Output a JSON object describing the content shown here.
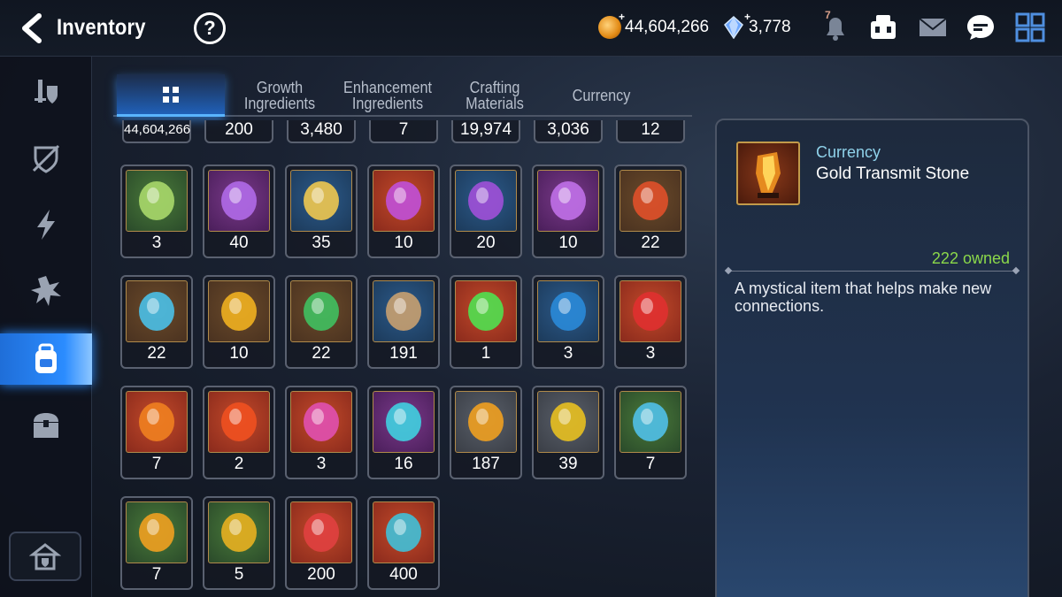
{
  "header": {
    "title": "Inventory",
    "help_label": "?",
    "gold_amount": "44,604,266",
    "crystal_amount": "3,778",
    "notification_count": "7"
  },
  "tabs": [
    {
      "label": "",
      "active": true
    },
    {
      "label": "Growth Ingredients"
    },
    {
      "label": "Enhancement Ingredients"
    },
    {
      "label": "Crafting Materials"
    },
    {
      "label": "Currency"
    }
  ],
  "top_row_counts": [
    "44,604,266",
    "200",
    "3,480",
    "7",
    "19,974",
    "3,036",
    "12"
  ],
  "items": [
    {
      "icon": "hero-portrait-icon",
      "count": "3"
    },
    {
      "icon": "purple-flower-icon",
      "count": "40"
    },
    {
      "icon": "gold-flower-icon",
      "count": "35"
    },
    {
      "icon": "moon-pentagon-rune-icon",
      "count": "10"
    },
    {
      "icon": "moon-triangle-rune-icon",
      "count": "20"
    },
    {
      "icon": "moon-oval-rune-icon",
      "count": "10"
    },
    {
      "icon": "red-fire-rune-icon",
      "count": "22"
    },
    {
      "icon": "blue-ice-rune-icon",
      "count": "22"
    },
    {
      "icon": "yellow-lightning-rune-icon",
      "count": "10"
    },
    {
      "icon": "green-earth-rune-icon",
      "count": "22"
    },
    {
      "icon": "herb-root-icon",
      "count": "191"
    },
    {
      "icon": "green-eye-gem-icon",
      "count": "1"
    },
    {
      "icon": "blue-circuit-orb-icon",
      "count": "3"
    },
    {
      "icon": "red-hexagon-gem-icon",
      "count": "3"
    },
    {
      "icon": "red-transmit-stone-icon",
      "count": "7"
    },
    {
      "icon": "red-bolt-stone-icon",
      "count": "2"
    },
    {
      "icon": "pink-potion-icon",
      "count": "3"
    },
    {
      "icon": "purple-cross-stone-icon",
      "count": "16"
    },
    {
      "icon": "grey-transmit-stone-icon",
      "count": "187"
    },
    {
      "icon": "grey-bolt-stone-icon",
      "count": "39"
    },
    {
      "icon": "green-cross-stone-icon",
      "count": "7"
    },
    {
      "icon": "white-transmit-stone-icon",
      "count": "7"
    },
    {
      "icon": "white-bolt-stone-icon",
      "count": "5"
    },
    {
      "icon": "dark-crystal-icon",
      "count": "200"
    },
    {
      "icon": "blue-shard-icon",
      "count": "400"
    }
  ],
  "detail": {
    "category": "Currency",
    "name": "Gold Transmit Stone",
    "owned": "222 owned",
    "description": "A mystical item that helps make new connections."
  },
  "colors": {
    "accent_blue": "#2b8cff",
    "owned_green": "#8bd84a",
    "category_cyan": "#8fd2ea"
  }
}
